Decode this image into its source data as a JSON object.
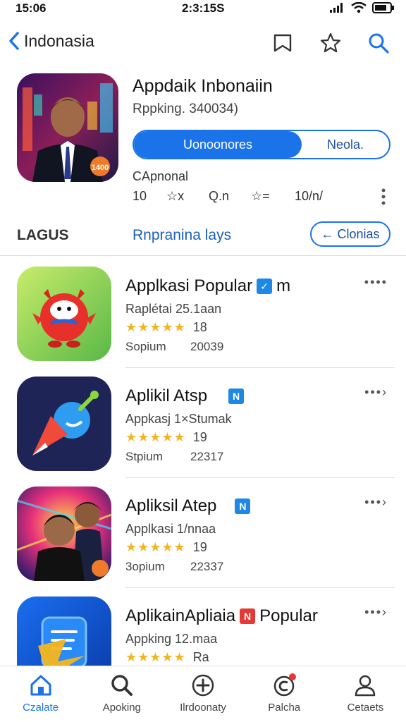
{
  "status": {
    "time_left": "15:06",
    "time_center": "2:3:15S"
  },
  "nav": {
    "back_label": "Indonasia"
  },
  "hero": {
    "title": "Appdaik Inbonaiin",
    "subtitle": "Rppking. 340034)",
    "seg_primary": "Uonoonores",
    "seg_secondary": "Neola.",
    "category": "CApnonal",
    "meta_a": "10",
    "meta_b": "☆x",
    "meta_c": "Q.n",
    "meta_d": "☆=",
    "meta_e": "10/n/",
    "badge_text": "1400"
  },
  "section": {
    "left": "LAGUS",
    "mid": "Rnpranina lays",
    "button": "← Clonias"
  },
  "items": [
    {
      "title": "Applkasi Popular",
      "title_suffix": "m",
      "sub": "Raplétai 25.1aan",
      "rating": "18",
      "foot_a": "Sopium",
      "foot_b": "20039"
    },
    {
      "title": "Aplikil Atsp",
      "title_suffix": "",
      "sub": "Appkasj 1×Stumak",
      "rating": "19",
      "foot_a": "Stpium",
      "foot_b": "22317"
    },
    {
      "title": "Apliksil Atep",
      "title_suffix": "",
      "sub": "Applkasi 1/nnaa",
      "rating": "19",
      "foot_a": "3opium",
      "foot_b": "22337"
    },
    {
      "title": "AplikainApliaia",
      "title_suffix": "Popular",
      "sub": "Appking 12.maa",
      "rating": "Ra",
      "foot_a": "",
      "foot_b": ""
    }
  ],
  "tabs": [
    {
      "label": "Czalate"
    },
    {
      "label": "Apoking"
    },
    {
      "label": "Ilrdoonaty"
    },
    {
      "label": "Palcha"
    },
    {
      "label": "Cetaets"
    }
  ],
  "colors": {
    "accent": "#1a73e8",
    "star": "#f2b51c",
    "badge_red": "#e53935"
  }
}
